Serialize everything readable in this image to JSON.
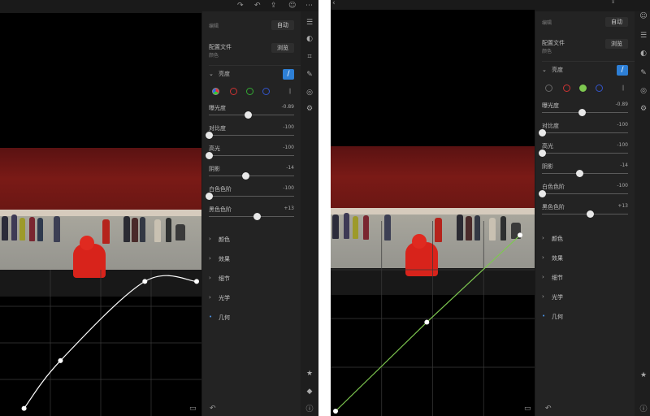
{
  "left": {
    "topbar": {
      "icons": [
        "redo-icon",
        "undo-icon",
        "share-icon",
        "profile-icon",
        "more-icon"
      ]
    },
    "panel": {
      "auto_label": "编辑",
      "auto_button": "自动",
      "profile_label": "配置文件",
      "profile_sub": "颜色",
      "browse_button": "浏览",
      "light_section": "亮度",
      "sliders": [
        {
          "label": "曝光度",
          "value": "-0.89",
          "pos": 0.46
        },
        {
          "label": "对比度",
          "value": "-100",
          "pos": 0.0
        },
        {
          "label": "高光",
          "value": "-100",
          "pos": 0.0
        },
        {
          "label": "阴影",
          "value": "-14",
          "pos": 0.43
        },
        {
          "label": "白色色阶",
          "value": "-100",
          "pos": 0.0
        },
        {
          "label": "黑色色阶",
          "value": "+13",
          "pos": 0.56
        }
      ],
      "sections": [
        "颜色",
        "效果",
        "细节",
        "光学",
        "几何"
      ]
    },
    "curve": {
      "points": [
        [
          0.1,
          0.02
        ],
        [
          0.29,
          0.37
        ],
        [
          0.73,
          0.95
        ],
        [
          1.0,
          0.95
        ]
      ]
    }
  },
  "right": {
    "panel": {
      "auto_label": "编辑",
      "auto_button": "自动",
      "profile_label": "配置文件",
      "profile_sub": "颜色",
      "browse_button": "浏览",
      "light_section": "亮度",
      "sliders": [
        {
          "label": "曝光度",
          "value": "-0.89",
          "pos": 0.46
        },
        {
          "label": "对比度",
          "value": "-100",
          "pos": 0.0
        },
        {
          "label": "高光",
          "value": "-100",
          "pos": 0.0
        },
        {
          "label": "阴影",
          "value": "-14",
          "pos": 0.43
        },
        {
          "label": "白色色阶",
          "value": "-100",
          "pos": 0.0
        },
        {
          "label": "黑色色阶",
          "value": "+13",
          "pos": 0.56
        }
      ],
      "sections": [
        "颜色",
        "效果",
        "细节",
        "光学",
        "几何"
      ]
    },
    "curve": {
      "points": [
        [
          0.0,
          0.0
        ],
        [
          0.47,
          0.48
        ],
        [
          0.95,
          0.95
        ]
      ]
    }
  },
  "colors": {
    "accent": "#2d7fd6",
    "curve_left": "#ffffff",
    "curve_right": "#7ec850",
    "wall": "#7a1a16",
    "kid": "#d8231b"
  }
}
